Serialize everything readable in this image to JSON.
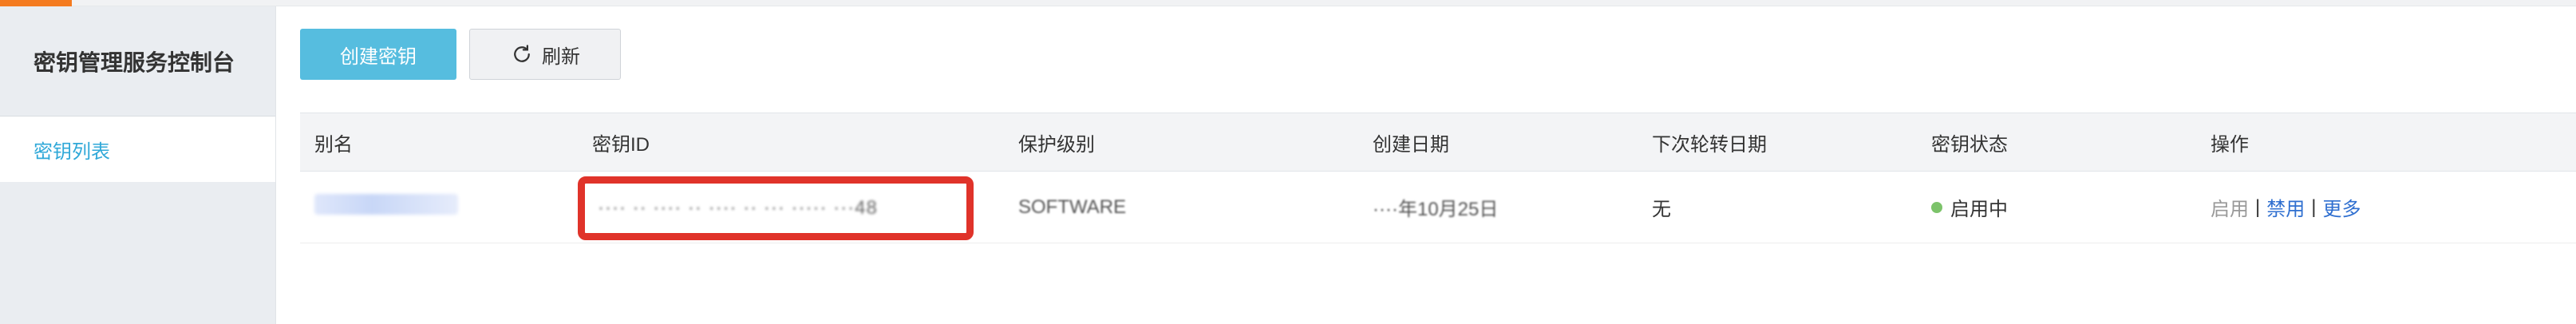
{
  "sidebar": {
    "title": "密钥管理服务控制台",
    "items": [
      {
        "label": "密钥列表"
      }
    ]
  },
  "toolbar": {
    "create_label": "创建密钥",
    "refresh_label": "刷新"
  },
  "table": {
    "columns": [
      "别名",
      "密钥ID",
      "保护级别",
      "创建日期",
      "下次轮转日期",
      "密钥状态",
      "操作"
    ],
    "rows": [
      {
        "alias": "",
        "key_id": "···· ·· ···· ·· ···· ·· ··· ····· ···48",
        "protection": "SOFTWARE",
        "created": "····年10月25日",
        "next_rotation": "无",
        "status": "启用中",
        "actions": {
          "enable": "启用",
          "sep": "|",
          "disable": "禁用",
          "more": "更多"
        }
      }
    ]
  },
  "colors": {
    "accent": "#56bddf",
    "highlight": "#e0332a",
    "status_on": "#7cc36a",
    "link": "#2f6fd0"
  }
}
